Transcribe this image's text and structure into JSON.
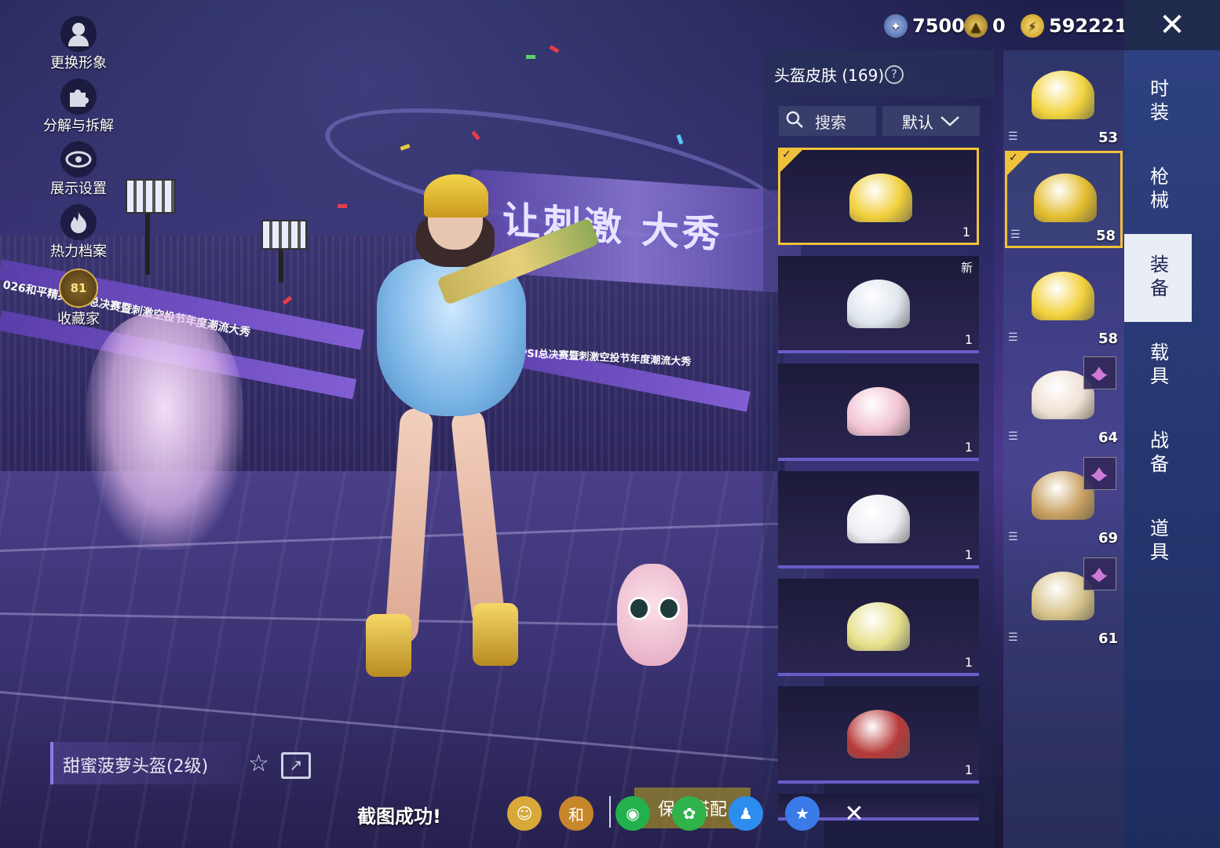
{
  "currencies": [
    {
      "name": "ticket-coin",
      "value": "7500",
      "color": "#4f6fb8"
    },
    {
      "name": "honor-coin",
      "value": "0",
      "color": "#c9a227"
    },
    {
      "name": "energy-coin",
      "value": "592221",
      "color": "#e6b325"
    }
  ],
  "side_menu": [
    {
      "label": "更换形象",
      "icon": "avatar-icon"
    },
    {
      "label": "分解与拆解",
      "icon": "puzzle-icon"
    },
    {
      "label": "展示设置",
      "icon": "eye-icon"
    },
    {
      "label": "热力档案",
      "icon": "flame-icon"
    },
    {
      "label": "收藏家",
      "icon": "collector-badge-icon",
      "badge": "81"
    }
  ],
  "scene": {
    "sign_text": "让刺激 大秀",
    "banner_texts": [
      "和平精英PSI总决赛暨刺激空投节年度潮流大秀",
      "026和平精英PSI总决赛暨刺激空投节年度潮流大秀"
    ]
  },
  "panel": {
    "title": "头盔皮肤 (169)",
    "help": "?",
    "search_placeholder": "搜索",
    "sort_label": "默认",
    "skins": [
      {
        "count": "1",
        "selected": true,
        "new": "",
        "color": "#f1cf3a"
      },
      {
        "count": "1",
        "selected": false,
        "new": "新",
        "color": "#dfe6ee"
      },
      {
        "count": "1",
        "selected": false,
        "new": "",
        "color": "#f2c3d2"
      },
      {
        "count": "1",
        "selected": false,
        "new": "",
        "color": "#eceef3"
      },
      {
        "count": "1",
        "selected": false,
        "new": "",
        "color": "#e6e08a"
      },
      {
        "count": "1",
        "selected": false,
        "new": "",
        "color": "#b83a3a"
      }
    ]
  },
  "equipped": [
    {
      "level": "53",
      "color": "#f2d33e",
      "selected": false,
      "badge": false
    },
    {
      "level": "58",
      "color": "#e4bd2e",
      "selected": true,
      "badge": false
    },
    {
      "level": "58",
      "color": "#f3d13c",
      "selected": false,
      "badge": false
    },
    {
      "level": "64",
      "color": "#efe0d4",
      "selected": false,
      "badge": true
    },
    {
      "level": "69",
      "color": "#c8a060",
      "selected": false,
      "badge": true
    },
    {
      "level": "61",
      "color": "#d8c48c",
      "selected": false,
      "badge": true
    }
  ],
  "tabs": [
    {
      "label": "时装",
      "active": false
    },
    {
      "label": "枪械",
      "active": false
    },
    {
      "label": "装备",
      "active": true
    },
    {
      "label": "载具",
      "active": false
    },
    {
      "label": "战备",
      "active": false
    },
    {
      "label": "道具",
      "active": false
    }
  ],
  "close_label": "✕",
  "item": {
    "name": "甜蜜菠萝头盔(2级)"
  },
  "screenshot": {
    "message": "截图成功!",
    "save_outfit_label": "保存搭配",
    "share_targets": [
      {
        "icon": "camp-icon",
        "color": "#d8a838"
      },
      {
        "icon": "game-for-peace-icon",
        "color": "#c8862a"
      },
      {
        "icon": "wechat-icon",
        "color": "#22b14c"
      },
      {
        "icon": "moments-icon",
        "color": "#2fb34a"
      },
      {
        "icon": "qq-icon",
        "color": "#2d8cf0"
      },
      {
        "icon": "qzone-icon",
        "color": "#3a7be8"
      },
      {
        "icon": "close-share-icon",
        "color": "#333333"
      }
    ]
  }
}
